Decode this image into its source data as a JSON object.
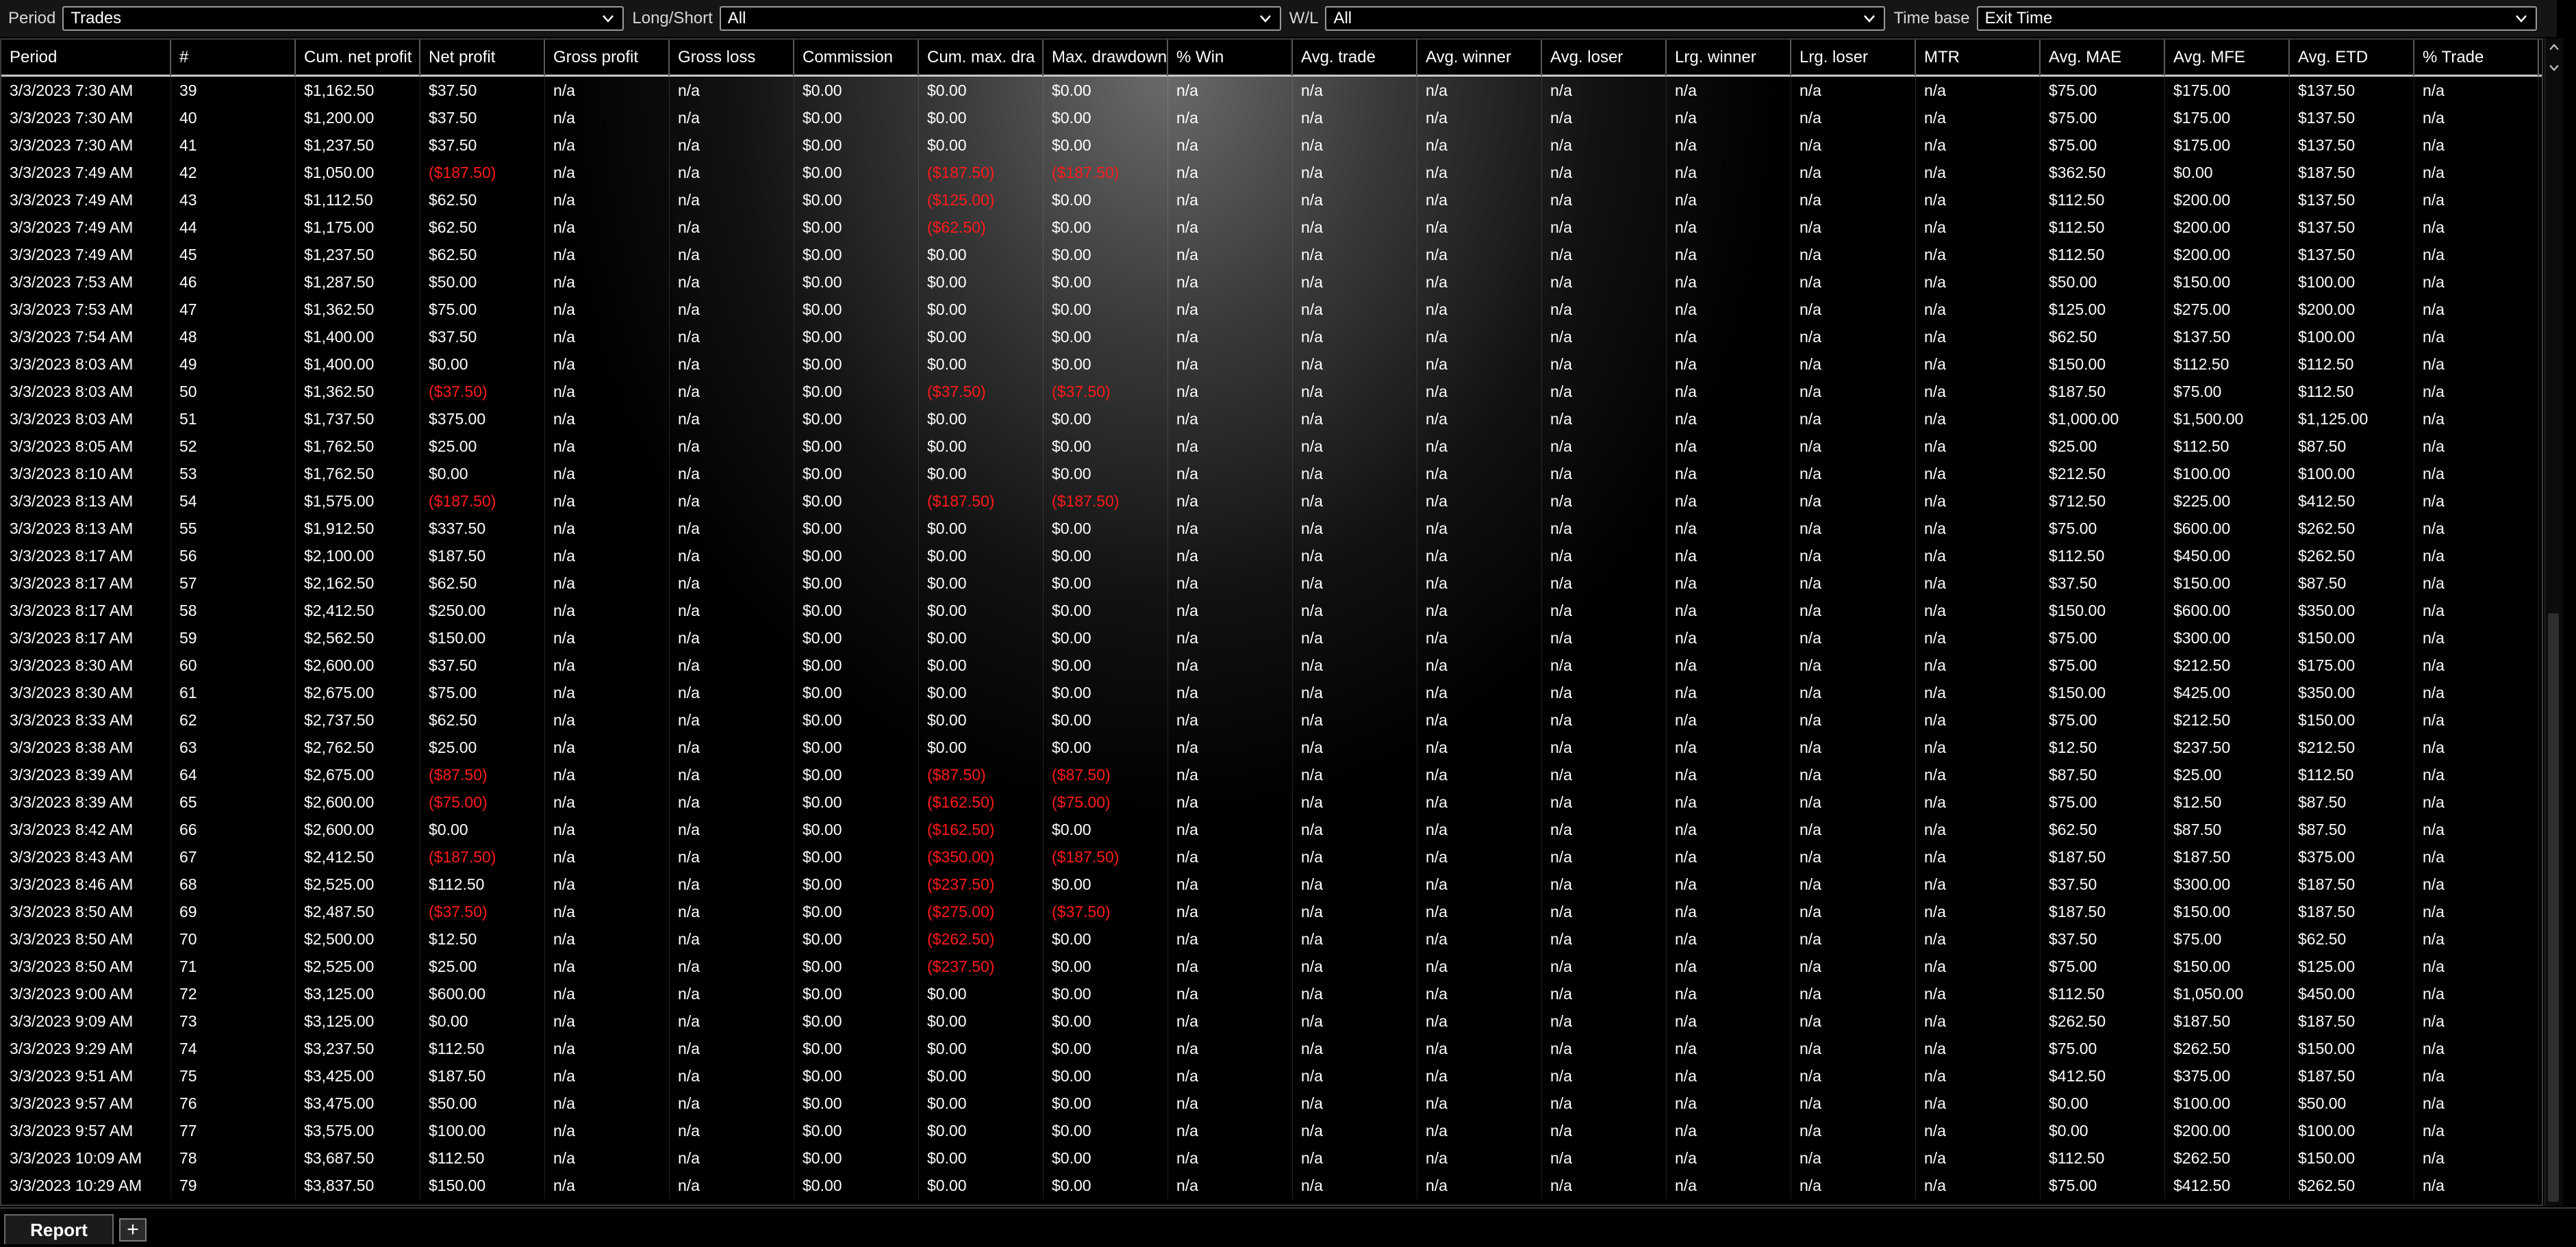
{
  "filters": {
    "period_label": "Period",
    "period_value": "Trades",
    "longshort_label": "Long/Short",
    "longshort_value": "All",
    "wl_label": "W/L",
    "wl_value": "All",
    "timebase_label": "Time base",
    "timebase_value": "Exit Time"
  },
  "columns": [
    "Period",
    "#",
    "Cum. net profit",
    "Net profit",
    "Gross profit",
    "Gross loss",
    "Commission",
    "Cum. max. dra",
    "Max. drawdown",
    "% Win",
    "Avg. trade",
    "Avg. winner",
    "Avg. loser",
    "Lrg. winner",
    "Lrg. loser",
    "MTR",
    "Avg. MAE",
    "Avg. MFE",
    "Avg. ETD",
    "% Trade"
  ],
  "rows": [
    [
      "3/3/2023 7:30 AM",
      "39",
      "$1,162.50",
      "$37.50",
      "n/a",
      "n/a",
      "$0.00",
      "$0.00",
      "$0.00",
      "n/a",
      "n/a",
      "n/a",
      "n/a",
      "n/a",
      "n/a",
      "n/a",
      "$75.00",
      "$175.00",
      "$137.50",
      "n/a"
    ],
    [
      "3/3/2023 7:30 AM",
      "40",
      "$1,200.00",
      "$37.50",
      "n/a",
      "n/a",
      "$0.00",
      "$0.00",
      "$0.00",
      "n/a",
      "n/a",
      "n/a",
      "n/a",
      "n/a",
      "n/a",
      "n/a",
      "$75.00",
      "$175.00",
      "$137.50",
      "n/a"
    ],
    [
      "3/3/2023 7:30 AM",
      "41",
      "$1,237.50",
      "$37.50",
      "n/a",
      "n/a",
      "$0.00",
      "$0.00",
      "$0.00",
      "n/a",
      "n/a",
      "n/a",
      "n/a",
      "n/a",
      "n/a",
      "n/a",
      "$75.00",
      "$175.00",
      "$137.50",
      "n/a"
    ],
    [
      "3/3/2023 7:49 AM",
      "42",
      "$1,050.00",
      "($187.50)",
      "n/a",
      "n/a",
      "$0.00",
      "($187.50)",
      "($187.50)",
      "n/a",
      "n/a",
      "n/a",
      "n/a",
      "n/a",
      "n/a",
      "n/a",
      "$362.50",
      "$0.00",
      "$187.50",
      "n/a"
    ],
    [
      "3/3/2023 7:49 AM",
      "43",
      "$1,112.50",
      "$62.50",
      "n/a",
      "n/a",
      "$0.00",
      "($125.00)",
      "$0.00",
      "n/a",
      "n/a",
      "n/a",
      "n/a",
      "n/a",
      "n/a",
      "n/a",
      "$112.50",
      "$200.00",
      "$137.50",
      "n/a"
    ],
    [
      "3/3/2023 7:49 AM",
      "44",
      "$1,175.00",
      "$62.50",
      "n/a",
      "n/a",
      "$0.00",
      "($62.50)",
      "$0.00",
      "n/a",
      "n/a",
      "n/a",
      "n/a",
      "n/a",
      "n/a",
      "n/a",
      "$112.50",
      "$200.00",
      "$137.50",
      "n/a"
    ],
    [
      "3/3/2023 7:49 AM",
      "45",
      "$1,237.50",
      "$62.50",
      "n/a",
      "n/a",
      "$0.00",
      "$0.00",
      "$0.00",
      "n/a",
      "n/a",
      "n/a",
      "n/a",
      "n/a",
      "n/a",
      "n/a",
      "$112.50",
      "$200.00",
      "$137.50",
      "n/a"
    ],
    [
      "3/3/2023 7:53 AM",
      "46",
      "$1,287.50",
      "$50.00",
      "n/a",
      "n/a",
      "$0.00",
      "$0.00",
      "$0.00",
      "n/a",
      "n/a",
      "n/a",
      "n/a",
      "n/a",
      "n/a",
      "n/a",
      "$50.00",
      "$150.00",
      "$100.00",
      "n/a"
    ],
    [
      "3/3/2023 7:53 AM",
      "47",
      "$1,362.50",
      "$75.00",
      "n/a",
      "n/a",
      "$0.00",
      "$0.00",
      "$0.00",
      "n/a",
      "n/a",
      "n/a",
      "n/a",
      "n/a",
      "n/a",
      "n/a",
      "$125.00",
      "$275.00",
      "$200.00",
      "n/a"
    ],
    [
      "3/3/2023 7:54 AM",
      "48",
      "$1,400.00",
      "$37.50",
      "n/a",
      "n/a",
      "$0.00",
      "$0.00",
      "$0.00",
      "n/a",
      "n/a",
      "n/a",
      "n/a",
      "n/a",
      "n/a",
      "n/a",
      "$62.50",
      "$137.50",
      "$100.00",
      "n/a"
    ],
    [
      "3/3/2023 8:03 AM",
      "49",
      "$1,400.00",
      "$0.00",
      "n/a",
      "n/a",
      "$0.00",
      "$0.00",
      "$0.00",
      "n/a",
      "n/a",
      "n/a",
      "n/a",
      "n/a",
      "n/a",
      "n/a",
      "$150.00",
      "$112.50",
      "$112.50",
      "n/a"
    ],
    [
      "3/3/2023 8:03 AM",
      "50",
      "$1,362.50",
      "($37.50)",
      "n/a",
      "n/a",
      "$0.00",
      "($37.50)",
      "($37.50)",
      "n/a",
      "n/a",
      "n/a",
      "n/a",
      "n/a",
      "n/a",
      "n/a",
      "$187.50",
      "$75.00",
      "$112.50",
      "n/a"
    ],
    [
      "3/3/2023 8:03 AM",
      "51",
      "$1,737.50",
      "$375.00",
      "n/a",
      "n/a",
      "$0.00",
      "$0.00",
      "$0.00",
      "n/a",
      "n/a",
      "n/a",
      "n/a",
      "n/a",
      "n/a",
      "n/a",
      "$1,000.00",
      "$1,500.00",
      "$1,125.00",
      "n/a"
    ],
    [
      "3/3/2023 8:05 AM",
      "52",
      "$1,762.50",
      "$25.00",
      "n/a",
      "n/a",
      "$0.00",
      "$0.00",
      "$0.00",
      "n/a",
      "n/a",
      "n/a",
      "n/a",
      "n/a",
      "n/a",
      "n/a",
      "$25.00",
      "$112.50",
      "$87.50",
      "n/a"
    ],
    [
      "3/3/2023 8:10 AM",
      "53",
      "$1,762.50",
      "$0.00",
      "n/a",
      "n/a",
      "$0.00",
      "$0.00",
      "$0.00",
      "n/a",
      "n/a",
      "n/a",
      "n/a",
      "n/a",
      "n/a",
      "n/a",
      "$212.50",
      "$100.00",
      "$100.00",
      "n/a"
    ],
    [
      "3/3/2023 8:13 AM",
      "54",
      "$1,575.00",
      "($187.50)",
      "n/a",
      "n/a",
      "$0.00",
      "($187.50)",
      "($187.50)",
      "n/a",
      "n/a",
      "n/a",
      "n/a",
      "n/a",
      "n/a",
      "n/a",
      "$712.50",
      "$225.00",
      "$412.50",
      "n/a"
    ],
    [
      "3/3/2023 8:13 AM",
      "55",
      "$1,912.50",
      "$337.50",
      "n/a",
      "n/a",
      "$0.00",
      "$0.00",
      "$0.00",
      "n/a",
      "n/a",
      "n/a",
      "n/a",
      "n/a",
      "n/a",
      "n/a",
      "$75.00",
      "$600.00",
      "$262.50",
      "n/a"
    ],
    [
      "3/3/2023 8:17 AM",
      "56",
      "$2,100.00",
      "$187.50",
      "n/a",
      "n/a",
      "$0.00",
      "$0.00",
      "$0.00",
      "n/a",
      "n/a",
      "n/a",
      "n/a",
      "n/a",
      "n/a",
      "n/a",
      "$112.50",
      "$450.00",
      "$262.50",
      "n/a"
    ],
    [
      "3/3/2023 8:17 AM",
      "57",
      "$2,162.50",
      "$62.50",
      "n/a",
      "n/a",
      "$0.00",
      "$0.00",
      "$0.00",
      "n/a",
      "n/a",
      "n/a",
      "n/a",
      "n/a",
      "n/a",
      "n/a",
      "$37.50",
      "$150.00",
      "$87.50",
      "n/a"
    ],
    [
      "3/3/2023 8:17 AM",
      "58",
      "$2,412.50",
      "$250.00",
      "n/a",
      "n/a",
      "$0.00",
      "$0.00",
      "$0.00",
      "n/a",
      "n/a",
      "n/a",
      "n/a",
      "n/a",
      "n/a",
      "n/a",
      "$150.00",
      "$600.00",
      "$350.00",
      "n/a"
    ],
    [
      "3/3/2023 8:17 AM",
      "59",
      "$2,562.50",
      "$150.00",
      "n/a",
      "n/a",
      "$0.00",
      "$0.00",
      "$0.00",
      "n/a",
      "n/a",
      "n/a",
      "n/a",
      "n/a",
      "n/a",
      "n/a",
      "$75.00",
      "$300.00",
      "$150.00",
      "n/a"
    ],
    [
      "3/3/2023 8:30 AM",
      "60",
      "$2,600.00",
      "$37.50",
      "n/a",
      "n/a",
      "$0.00",
      "$0.00",
      "$0.00",
      "n/a",
      "n/a",
      "n/a",
      "n/a",
      "n/a",
      "n/a",
      "n/a",
      "$75.00",
      "$212.50",
      "$175.00",
      "n/a"
    ],
    [
      "3/3/2023 8:30 AM",
      "61",
      "$2,675.00",
      "$75.00",
      "n/a",
      "n/a",
      "$0.00",
      "$0.00",
      "$0.00",
      "n/a",
      "n/a",
      "n/a",
      "n/a",
      "n/a",
      "n/a",
      "n/a",
      "$150.00",
      "$425.00",
      "$350.00",
      "n/a"
    ],
    [
      "3/3/2023 8:33 AM",
      "62",
      "$2,737.50",
      "$62.50",
      "n/a",
      "n/a",
      "$0.00",
      "$0.00",
      "$0.00",
      "n/a",
      "n/a",
      "n/a",
      "n/a",
      "n/a",
      "n/a",
      "n/a",
      "$75.00",
      "$212.50",
      "$150.00",
      "n/a"
    ],
    [
      "3/3/2023 8:38 AM",
      "63",
      "$2,762.50",
      "$25.00",
      "n/a",
      "n/a",
      "$0.00",
      "$0.00",
      "$0.00",
      "n/a",
      "n/a",
      "n/a",
      "n/a",
      "n/a",
      "n/a",
      "n/a",
      "$12.50",
      "$237.50",
      "$212.50",
      "n/a"
    ],
    [
      "3/3/2023 8:39 AM",
      "64",
      "$2,675.00",
      "($87.50)",
      "n/a",
      "n/a",
      "$0.00",
      "($87.50)",
      "($87.50)",
      "n/a",
      "n/a",
      "n/a",
      "n/a",
      "n/a",
      "n/a",
      "n/a",
      "$87.50",
      "$25.00",
      "$112.50",
      "n/a"
    ],
    [
      "3/3/2023 8:39 AM",
      "65",
      "$2,600.00",
      "($75.00)",
      "n/a",
      "n/a",
      "$0.00",
      "($162.50)",
      "($75.00)",
      "n/a",
      "n/a",
      "n/a",
      "n/a",
      "n/a",
      "n/a",
      "n/a",
      "$75.00",
      "$12.50",
      "$87.50",
      "n/a"
    ],
    [
      "3/3/2023 8:42 AM",
      "66",
      "$2,600.00",
      "$0.00",
      "n/a",
      "n/a",
      "$0.00",
      "($162.50)",
      "$0.00",
      "n/a",
      "n/a",
      "n/a",
      "n/a",
      "n/a",
      "n/a",
      "n/a",
      "$62.50",
      "$87.50",
      "$87.50",
      "n/a"
    ],
    [
      "3/3/2023 8:43 AM",
      "67",
      "$2,412.50",
      "($187.50)",
      "n/a",
      "n/a",
      "$0.00",
      "($350.00)",
      "($187.50)",
      "n/a",
      "n/a",
      "n/a",
      "n/a",
      "n/a",
      "n/a",
      "n/a",
      "$187.50",
      "$187.50",
      "$375.00",
      "n/a"
    ],
    [
      "3/3/2023 8:46 AM",
      "68",
      "$2,525.00",
      "$112.50",
      "n/a",
      "n/a",
      "$0.00",
      "($237.50)",
      "$0.00",
      "n/a",
      "n/a",
      "n/a",
      "n/a",
      "n/a",
      "n/a",
      "n/a",
      "$37.50",
      "$300.00",
      "$187.50",
      "n/a"
    ],
    [
      "3/3/2023 8:50 AM",
      "69",
      "$2,487.50",
      "($37.50)",
      "n/a",
      "n/a",
      "$0.00",
      "($275.00)",
      "($37.50)",
      "n/a",
      "n/a",
      "n/a",
      "n/a",
      "n/a",
      "n/a",
      "n/a",
      "$187.50",
      "$150.00",
      "$187.50",
      "n/a"
    ],
    [
      "3/3/2023 8:50 AM",
      "70",
      "$2,500.00",
      "$12.50",
      "n/a",
      "n/a",
      "$0.00",
      "($262.50)",
      "$0.00",
      "n/a",
      "n/a",
      "n/a",
      "n/a",
      "n/a",
      "n/a",
      "n/a",
      "$37.50",
      "$75.00",
      "$62.50",
      "n/a"
    ],
    [
      "3/3/2023 8:50 AM",
      "71",
      "$2,525.00",
      "$25.00",
      "n/a",
      "n/a",
      "$0.00",
      "($237.50)",
      "$0.00",
      "n/a",
      "n/a",
      "n/a",
      "n/a",
      "n/a",
      "n/a",
      "n/a",
      "$75.00",
      "$150.00",
      "$125.00",
      "n/a"
    ],
    [
      "3/3/2023 9:00 AM",
      "72",
      "$3,125.00",
      "$600.00",
      "n/a",
      "n/a",
      "$0.00",
      "$0.00",
      "$0.00",
      "n/a",
      "n/a",
      "n/a",
      "n/a",
      "n/a",
      "n/a",
      "n/a",
      "$112.50",
      "$1,050.00",
      "$450.00",
      "n/a"
    ],
    [
      "3/3/2023 9:09 AM",
      "73",
      "$3,125.00",
      "$0.00",
      "n/a",
      "n/a",
      "$0.00",
      "$0.00",
      "$0.00",
      "n/a",
      "n/a",
      "n/a",
      "n/a",
      "n/a",
      "n/a",
      "n/a",
      "$262.50",
      "$187.50",
      "$187.50",
      "n/a"
    ],
    [
      "3/3/2023 9:29 AM",
      "74",
      "$3,237.50",
      "$112.50",
      "n/a",
      "n/a",
      "$0.00",
      "$0.00",
      "$0.00",
      "n/a",
      "n/a",
      "n/a",
      "n/a",
      "n/a",
      "n/a",
      "n/a",
      "$75.00",
      "$262.50",
      "$150.00",
      "n/a"
    ],
    [
      "3/3/2023 9:51 AM",
      "75",
      "$3,425.00",
      "$187.50",
      "n/a",
      "n/a",
      "$0.00",
      "$0.00",
      "$0.00",
      "n/a",
      "n/a",
      "n/a",
      "n/a",
      "n/a",
      "n/a",
      "n/a",
      "$412.50",
      "$375.00",
      "$187.50",
      "n/a"
    ],
    [
      "3/3/2023 9:57 AM",
      "76",
      "$3,475.00",
      "$50.00",
      "n/a",
      "n/a",
      "$0.00",
      "$0.00",
      "$0.00",
      "n/a",
      "n/a",
      "n/a",
      "n/a",
      "n/a",
      "n/a",
      "n/a",
      "$0.00",
      "$100.00",
      "$50.00",
      "n/a"
    ],
    [
      "3/3/2023 9:57 AM",
      "77",
      "$3,575.00",
      "$100.00",
      "n/a",
      "n/a",
      "$0.00",
      "$0.00",
      "$0.00",
      "n/a",
      "n/a",
      "n/a",
      "n/a",
      "n/a",
      "n/a",
      "n/a",
      "$0.00",
      "$200.00",
      "$100.00",
      "n/a"
    ],
    [
      "3/3/2023 10:09 AM",
      "78",
      "$3,687.50",
      "$112.50",
      "n/a",
      "n/a",
      "$0.00",
      "$0.00",
      "$0.00",
      "n/a",
      "n/a",
      "n/a",
      "n/a",
      "n/a",
      "n/a",
      "n/a",
      "$112.50",
      "$262.50",
      "$150.00",
      "n/a"
    ],
    [
      "3/3/2023 10:29 AM",
      "79",
      "$3,837.50",
      "$150.00",
      "n/a",
      "n/a",
      "$0.00",
      "$0.00",
      "$0.00",
      "n/a",
      "n/a",
      "n/a",
      "n/a",
      "n/a",
      "n/a",
      "n/a",
      "$75.00",
      "$412.50",
      "$262.50",
      "n/a"
    ]
  ],
  "tabs": {
    "report_label": "Report",
    "add_label": "+"
  },
  "colors": {
    "negative": "#ff1a1a",
    "background": "#000000",
    "text": "#ffffff"
  },
  "icons": {
    "dropdown": "chevron-down-icon",
    "scroll_up": "chevron-up-icon",
    "scroll_down": "chevron-down-icon"
  }
}
